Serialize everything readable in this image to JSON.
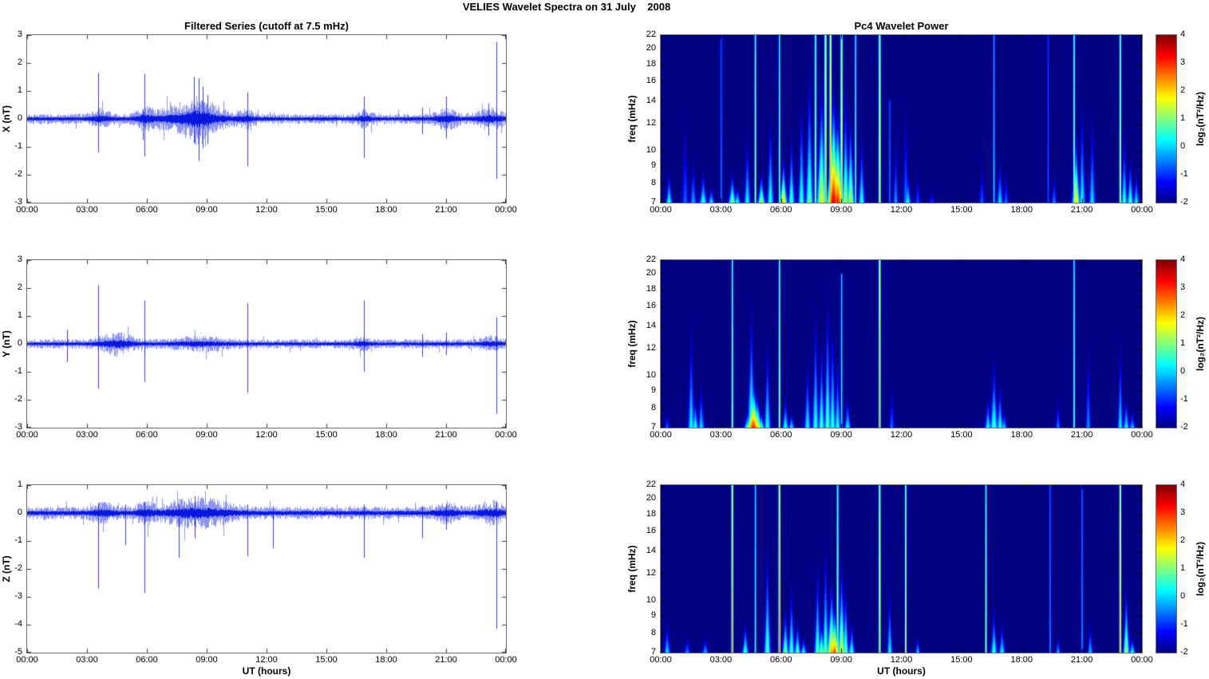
{
  "figure": {
    "title": "VELIES Wavelet Spectra on 31 July    2008",
    "background": "#ffffff"
  },
  "time_axis": {
    "label": "UT (hours)",
    "ticks": [
      "00:00",
      "03:00",
      "06:00",
      "09:00",
      "12:00",
      "15:00",
      "18:00",
      "21:00",
      "00:00"
    ],
    "range_hours": [
      0,
      24
    ]
  },
  "colors": {
    "series_line": "#0010dd",
    "heatmap_background": "#000080",
    "axis_frame": "#6e6e6e"
  },
  "chart_data": [
    {
      "type": "line",
      "title": "Filtered Series (cutoff at 7.5 mHz)",
      "ylabel": "X (nT)",
      "xlabel": "",
      "ylim": [
        -3,
        3
      ],
      "yticks": [
        3,
        2,
        1,
        0,
        -1,
        -2,
        -3
      ],
      "xticks": [
        "00:00",
        "03:00",
        "06:00",
        "09:00",
        "12:00",
        "15:00",
        "18:00",
        "21:00",
        "00:00"
      ],
      "line_color": "#0010dd",
      "noise_base": 0.09,
      "bursts": [
        [
          3.7,
          0.35,
          0.1
        ],
        [
          5.9,
          0.3,
          0.12
        ],
        [
          8.3,
          1.2,
          0.22
        ],
        [
          8.6,
          0.4,
          0.15
        ],
        [
          11.0,
          0.3,
          0.08
        ],
        [
          16.9,
          0.3,
          0.08
        ],
        [
          21.0,
          0.4,
          0.12
        ],
        [
          23.2,
          0.5,
          0.12
        ]
      ],
      "spikes": [
        [
          3.55,
          1.65,
          -1.2
        ],
        [
          5.8,
          0.3,
          -0.75
        ],
        [
          5.88,
          1.6,
          -1.35
        ],
        [
          8.35,
          1.5,
          -0.85
        ],
        [
          8.6,
          1.45,
          -1.5
        ],
        [
          8.8,
          1.15,
          -1.05
        ],
        [
          9.05,
          0.85,
          -0.9
        ],
        [
          11.05,
          0.95,
          -1.7
        ],
        [
          16.9,
          0.8,
          -1.4
        ],
        [
          19.8,
          0.4,
          -0.55
        ],
        [
          21.0,
          0.8,
          -0.7
        ],
        [
          23.1,
          0.55,
          -0.6
        ],
        [
          23.5,
          2.75,
          -2.15
        ]
      ]
    },
    {
      "type": "line",
      "title": "",
      "ylabel": "Y (nT)",
      "xlabel": "",
      "ylim": [
        -3,
        3
      ],
      "yticks": [
        3,
        2,
        1,
        0,
        -1,
        -2,
        -3
      ],
      "xticks": [
        "00:00",
        "03:00",
        "06:00",
        "09:00",
        "12:00",
        "15:00",
        "18:00",
        "21:00",
        "00:00"
      ],
      "line_color": "#0010dd",
      "noise_base": 0.08,
      "bursts": [
        [
          4.5,
          0.6,
          0.14
        ],
        [
          8.6,
          1.0,
          0.07
        ],
        [
          16.8,
          0.3,
          0.06
        ],
        [
          23.2,
          0.4,
          0.07
        ]
      ],
      "spikes": [
        [
          2.0,
          0.5,
          -0.65
        ],
        [
          3.55,
          2.1,
          -1.6
        ],
        [
          5.88,
          1.55,
          -1.35
        ],
        [
          11.05,
          1.45,
          -1.75
        ],
        [
          16.9,
          1.55,
          -1.0
        ],
        [
          19.8,
          0.35,
          -0.45
        ],
        [
          21.0,
          0.4,
          -0.4
        ],
        [
          23.5,
          0.95,
          -2.5
        ]
      ]
    },
    {
      "type": "line",
      "title": "",
      "ylabel": "Z (nT)",
      "xlabel": "UT (hours)",
      "ylim": [
        -5,
        1
      ],
      "yticks": [
        1,
        0,
        -1,
        -2,
        -3,
        -4,
        -5
      ],
      "xticks": [
        "00:00",
        "03:00",
        "06:00",
        "09:00",
        "12:00",
        "15:00",
        "18:00",
        "21:00",
        "00:00"
      ],
      "line_color": "#0010dd",
      "noise_base": 0.11,
      "bursts": [
        [
          3.8,
          0.4,
          0.1
        ],
        [
          5.9,
          0.3,
          0.1
        ],
        [
          8.5,
          1.2,
          0.18
        ],
        [
          21.0,
          0.4,
          0.1
        ],
        [
          23.2,
          0.5,
          0.12
        ]
      ],
      "spikes": [
        [
          3.55,
          0.35,
          -2.7
        ],
        [
          4.9,
          0.3,
          -1.15
        ],
        [
          5.88,
          0.4,
          -2.85
        ],
        [
          7.6,
          0.35,
          -1.6
        ],
        [
          8.4,
          0.6,
          -0.9
        ],
        [
          11.05,
          0.3,
          -1.55
        ],
        [
          12.3,
          0.25,
          -1.25
        ],
        [
          16.9,
          0.3,
          -1.6
        ],
        [
          19.8,
          0.25,
          -0.9
        ],
        [
          21.0,
          0.3,
          -0.6
        ],
        [
          23.5,
          0.4,
          -4.15
        ]
      ]
    },
    {
      "type": "heatmap",
      "title": "Pc4 Wavelet Power",
      "ylabel": "freq (mHz)",
      "xlabel": "",
      "flim": [
        7,
        22
      ],
      "yticks": [
        22,
        20,
        18,
        16,
        14,
        12,
        10,
        9,
        8,
        7
      ],
      "xticks": [
        "00:00",
        "03:00",
        "06:00",
        "09:00",
        "12:00",
        "15:00",
        "18:00",
        "21:00",
        "00:00"
      ],
      "clim": [
        -2,
        4
      ],
      "colormap": "jet",
      "colorbar_label": "log₂(nT²/Hz)",
      "colorbar_ticks": [
        4,
        3,
        2,
        1,
        0,
        -1,
        -2
      ],
      "events": [
        [
          0.4,
          9,
          0.6,
          1,
          0
        ],
        [
          1.2,
          14,
          -0.6,
          1,
          0
        ],
        [
          1.6,
          10,
          -0.1,
          1,
          0
        ],
        [
          2.1,
          9,
          0.7,
          1.2,
          0
        ],
        [
          2.5,
          8,
          0.4,
          1,
          0
        ],
        [
          3.0,
          22,
          -0.4,
          0.8,
          1
        ],
        [
          3.55,
          9,
          1.2,
          1.2,
          0
        ],
        [
          3.8,
          8,
          0.6,
          1,
          0
        ],
        [
          4.3,
          12,
          0.4,
          1,
          0
        ],
        [
          4.7,
          22,
          1.6,
          0.8,
          1
        ],
        [
          5.0,
          9,
          1.4,
          1.2,
          0
        ],
        [
          5.45,
          14,
          0.6,
          1,
          0
        ],
        [
          5.9,
          22,
          1.2,
          0.8,
          1
        ],
        [
          6.1,
          10,
          2.2,
          1.2,
          0
        ],
        [
          6.5,
          12,
          0.9,
          1,
          0
        ],
        [
          7.0,
          16,
          0.7,
          1,
          0
        ],
        [
          7.4,
          20,
          1.0,
          1.2,
          0
        ],
        [
          7.7,
          22,
          1.4,
          1,
          1
        ],
        [
          8.0,
          18,
          1.8,
          1.5,
          0
        ],
        [
          8.2,
          22,
          2.4,
          1,
          1
        ],
        [
          8.45,
          22,
          2.6,
          1,
          1
        ],
        [
          8.6,
          16,
          3.6,
          2,
          0
        ],
        [
          8.8,
          14,
          3.2,
          2,
          0
        ],
        [
          9.0,
          22,
          2.2,
          1,
          1
        ],
        [
          9.2,
          16,
          1.4,
          1.2,
          0
        ],
        [
          9.45,
          14,
          1.6,
          1.2,
          0
        ],
        [
          9.7,
          22,
          1.0,
          0.8,
          1
        ],
        [
          10.0,
          12,
          0.6,
          1,
          0
        ],
        [
          10.9,
          22,
          2.1,
          1,
          1
        ],
        [
          11.4,
          14,
          -0.4,
          0.8,
          1
        ],
        [
          11.7,
          12,
          -0.2,
          0.8,
          0
        ],
        [
          12.2,
          16,
          -0.4,
          0.8,
          0
        ],
        [
          12.3,
          9,
          0.5,
          1,
          0
        ],
        [
          12.8,
          9,
          -0.7,
          0.8,
          0
        ],
        [
          13.5,
          8,
          -0.9,
          0.8,
          0
        ],
        [
          16.0,
          10,
          -0.6,
          0.8,
          0
        ],
        [
          16.6,
          22,
          0.3,
          0.8,
          1
        ],
        [
          16.9,
          10,
          0.2,
          1,
          0
        ],
        [
          17.2,
          9,
          -0.5,
          0.8,
          0
        ],
        [
          19.3,
          22,
          -0.6,
          0.8,
          1
        ],
        [
          19.6,
          9,
          -0.3,
          0.8,
          0
        ],
        [
          20.6,
          22,
          1.3,
          0.9,
          1
        ],
        [
          20.7,
          12,
          2.0,
          1.2,
          0
        ],
        [
          21.0,
          16,
          0.4,
          1,
          0
        ],
        [
          21.5,
          14,
          0.2,
          1,
          0
        ],
        [
          22.9,
          22,
          1.8,
          0.9,
          1
        ],
        [
          23.1,
          12,
          0.6,
          1,
          0
        ],
        [
          23.4,
          10,
          0.8,
          1,
          0
        ],
        [
          23.7,
          9,
          0.3,
          1,
          0
        ]
      ]
    },
    {
      "type": "heatmap",
      "title": "",
      "ylabel": "freq (mHz)",
      "xlabel": "",
      "flim": [
        7,
        22
      ],
      "yticks": [
        22,
        20,
        18,
        16,
        14,
        12,
        10,
        9,
        8,
        7
      ],
      "xticks": [
        "00:00",
        "03:00",
        "06:00",
        "09:00",
        "12:00",
        "15:00",
        "18:00",
        "21:00",
        "00:00"
      ],
      "clim": [
        -2,
        4
      ],
      "colormap": "jet",
      "colorbar_label": "log₂(nT²/Hz)",
      "colorbar_ticks": [
        4,
        3,
        2,
        1,
        0,
        -1,
        -2
      ],
      "events": [
        [
          0.3,
          8,
          -0.5,
          0.8,
          0
        ],
        [
          1.5,
          16,
          0.4,
          1,
          0
        ],
        [
          1.7,
          9,
          0.7,
          1,
          0
        ],
        [
          2.0,
          10,
          0.2,
          1,
          0
        ],
        [
          3.55,
          22,
          1.5,
          0.8,
          1
        ],
        [
          4.3,
          8,
          0.8,
          1,
          0
        ],
        [
          4.5,
          18,
          1.0,
          1.2,
          0
        ],
        [
          4.6,
          10,
          3.2,
          2.2,
          0
        ],
        [
          4.8,
          9,
          2.2,
          1.5,
          0
        ],
        [
          5.0,
          8,
          1.0,
          1,
          0
        ],
        [
          5.3,
          14,
          0.5,
          1,
          0
        ],
        [
          5.9,
          22,
          1.7,
          0.8,
          1
        ],
        [
          6.2,
          9,
          0.6,
          1,
          0
        ],
        [
          6.5,
          8,
          0.3,
          1,
          0
        ],
        [
          7.3,
          12,
          0.4,
          1,
          0
        ],
        [
          7.7,
          18,
          0.6,
          1,
          0
        ],
        [
          8.0,
          14,
          0.8,
          1,
          0
        ],
        [
          8.3,
          20,
          0.9,
          1,
          0
        ],
        [
          8.55,
          16,
          0.7,
          1,
          0
        ],
        [
          8.8,
          12,
          0.5,
          1,
          0
        ],
        [
          9.0,
          20,
          0.6,
          0.8,
          1
        ],
        [
          9.3,
          9,
          0.4,
          1,
          0
        ],
        [
          10.9,
          22,
          2.6,
          0.9,
          1
        ],
        [
          11.5,
          10,
          -0.5,
          0.8,
          0
        ],
        [
          16.3,
          9,
          0.5,
          1,
          0
        ],
        [
          16.6,
          12,
          0.8,
          1.2,
          0
        ],
        [
          16.9,
          10,
          0.6,
          1,
          0
        ],
        [
          17.1,
          8,
          0.2,
          1,
          0
        ],
        [
          19.8,
          9,
          -0.4,
          0.8,
          0
        ],
        [
          20.6,
          22,
          1.0,
          0.8,
          1
        ],
        [
          21.3,
          14,
          -0.3,
          0.8,
          0
        ],
        [
          22.9,
          14,
          0.3,
          0.8,
          0
        ],
        [
          23.2,
          9,
          0.4,
          1,
          0
        ],
        [
          23.5,
          8,
          0.1,
          1,
          0
        ]
      ]
    },
    {
      "type": "heatmap",
      "title": "",
      "ylabel": "freq (mHz)",
      "xlabel": "UT (hours)",
      "flim": [
        7,
        22
      ],
      "yticks": [
        22,
        20,
        18,
        16,
        14,
        12,
        10,
        9,
        8,
        7
      ],
      "xticks": [
        "00:00",
        "03:00",
        "06:00",
        "09:00",
        "12:00",
        "15:00",
        "18:00",
        "21:00",
        "00:00"
      ],
      "clim": [
        -2,
        4
      ],
      "colormap": "jet",
      "colorbar_label": "log₂(nT²/Hz)",
      "colorbar_ticks": [
        4,
        3,
        2,
        1,
        0,
        -1,
        -2
      ],
      "events": [
        [
          0.3,
          9,
          0.2,
          1,
          0
        ],
        [
          1.3,
          8,
          -0.3,
          1,
          0
        ],
        [
          2.2,
          8,
          0.0,
          1,
          0
        ],
        [
          3.55,
          22,
          2.8,
          0.9,
          1
        ],
        [
          4.2,
          9,
          0.8,
          1,
          0
        ],
        [
          4.7,
          22,
          0.8,
          0.8,
          1
        ],
        [
          5.3,
          16,
          0.9,
          1,
          0
        ],
        [
          5.9,
          22,
          2.9,
          0.9,
          1
        ],
        [
          6.2,
          10,
          1.2,
          1,
          0
        ],
        [
          6.5,
          12,
          0.8,
          1,
          0
        ],
        [
          6.8,
          9,
          1.0,
          1,
          0
        ],
        [
          7.1,
          8,
          0.5,
          1,
          0
        ],
        [
          7.8,
          14,
          0.9,
          1,
          0
        ],
        [
          8.0,
          9,
          1.3,
          1.2,
          0
        ],
        [
          8.2,
          16,
          1.0,
          1,
          0
        ],
        [
          8.5,
          12,
          2.4,
          1.5,
          0
        ],
        [
          8.65,
          10,
          3.0,
          1.5,
          0
        ],
        [
          8.8,
          22,
          1.5,
          0.9,
          1
        ],
        [
          9.0,
          14,
          1.8,
          1.2,
          0
        ],
        [
          9.2,
          12,
          1.0,
          1,
          0
        ],
        [
          9.5,
          9,
          0.7,
          1,
          0
        ],
        [
          10.9,
          22,
          2.2,
          0.9,
          1
        ],
        [
          11.4,
          12,
          0.4,
          0.8,
          0
        ],
        [
          12.2,
          22,
          2.0,
          0.8,
          1
        ],
        [
          12.8,
          8,
          0.2,
          0.8,
          0
        ],
        [
          16.2,
          22,
          1.6,
          0.8,
          1
        ],
        [
          16.6,
          10,
          0.7,
          1,
          0
        ],
        [
          17.0,
          9,
          0.4,
          1,
          0
        ],
        [
          19.4,
          22,
          -0.3,
          0.8,
          1
        ],
        [
          19.8,
          8,
          0.0,
          0.8,
          0
        ],
        [
          21.0,
          22,
          -0.2,
          0.8,
          1
        ],
        [
          21.4,
          9,
          0.1,
          0.8,
          0
        ],
        [
          22.9,
          22,
          2.7,
          0.9,
          1
        ],
        [
          23.2,
          12,
          1.4,
          1,
          0
        ],
        [
          23.5,
          8,
          0.6,
          1,
          0
        ]
      ]
    }
  ]
}
